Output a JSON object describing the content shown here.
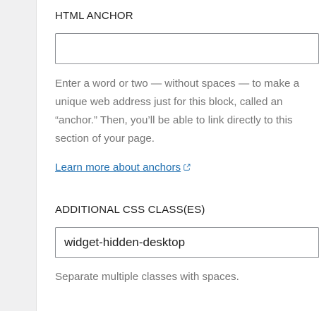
{
  "anchor": {
    "label": "HTML ANCHOR",
    "value": "",
    "help": "Enter a word or two — without spaces — to make a unique web address just for this block, called an “anchor.” Then, you’ll be able to link directly to this section of your page.",
    "learn_more": "Learn more about anchors",
    "external_icon": "external-link-icon"
  },
  "css_class": {
    "label": "ADDITIONAL CSS CLASS(ES)",
    "value": "widget-hidden-desktop",
    "help": "Separate multiple classes with spaces."
  },
  "colors": {
    "link": "#2271b1",
    "help_text": "#757575",
    "label": "#1e1e1e",
    "input_border": "#8c8f94",
    "gutter": "#f0f0f1"
  }
}
